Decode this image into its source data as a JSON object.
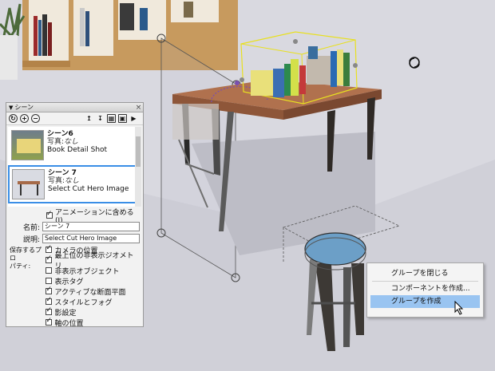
{
  "scenes_panel": {
    "title": "シーン",
    "toolbar_icons": [
      "refresh-icon",
      "add-icon",
      "remove-icon",
      "move-up-icon",
      "move-down-icon",
      "view-options-icon",
      "details-icon"
    ],
    "scenes": [
      {
        "name": "シーン6",
        "photo_label": "写真:",
        "photo_value": "なし",
        "description": "Book Detail Shot",
        "selected": false
      },
      {
        "name": "シーン 7",
        "photo_label": "写真:",
        "photo_value": "なし",
        "description": "Select Cut Hero Image",
        "selected": true
      }
    ],
    "include_in_animation": "アニメーションに含める(I)",
    "name_label": "名前:",
    "name_value": "シーン 7",
    "description_label": "説明:",
    "description_value": "Select Cut Hero Image",
    "properties_label_1": "保存するプロ",
    "properties_label_2": "パティ:",
    "properties": [
      {
        "label": "カメラの位置",
        "checked": true
      },
      {
        "label": "最上位の非表示ジオメトリ",
        "checked": true
      },
      {
        "label": "非表示オブジェクト",
        "checked": false
      },
      {
        "label": "表示タグ",
        "checked": false
      },
      {
        "label": "アクティブな断面平面",
        "checked": true
      },
      {
        "label": "スタイルとフォグ",
        "checked": true
      },
      {
        "label": "影設定",
        "checked": true
      },
      {
        "label": "軸の位置",
        "checked": true
      }
    ]
  },
  "context_menu": {
    "items": [
      {
        "label": "グループを閉じる",
        "highlighted": false
      },
      {
        "label": "コンポーネントを作成...",
        "highlighted": false
      },
      {
        "label": "グループを作成",
        "highlighted": true
      }
    ]
  },
  "colors": {
    "selection_blue": "#3a8ee6",
    "highlight_blue": "#99c4f1",
    "bounding_box_yellow": "#e8e020",
    "table_top": "#b0714e",
    "stool_seat": "#6c9fc7"
  }
}
